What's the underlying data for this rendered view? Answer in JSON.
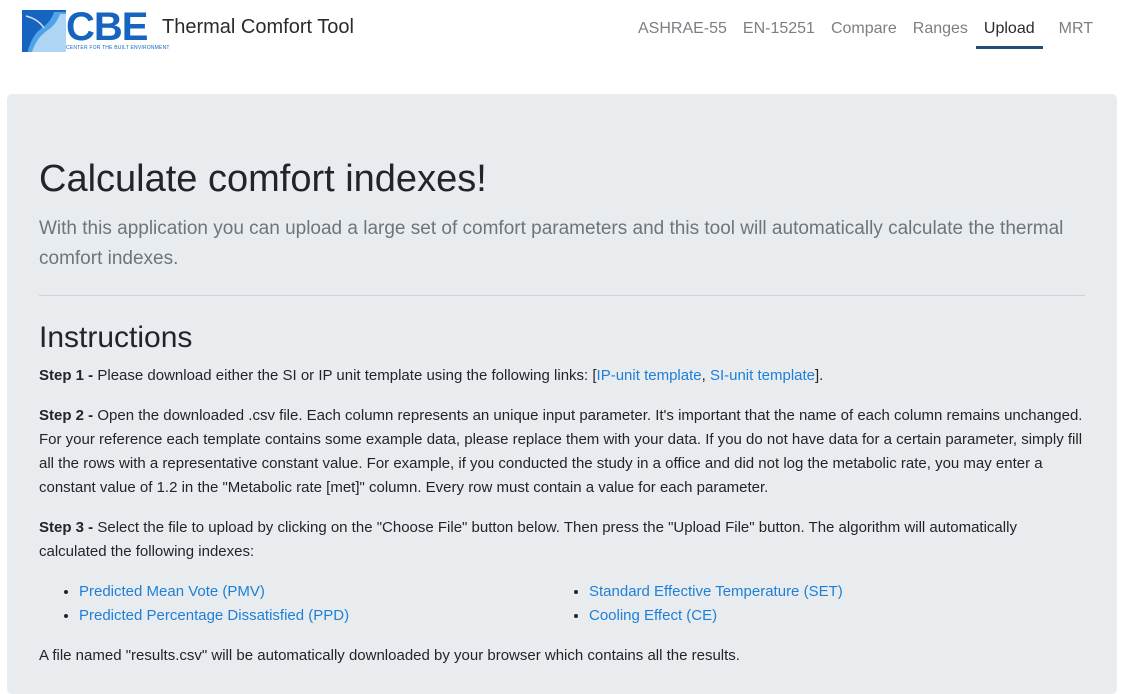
{
  "header": {
    "logo_text": "CBE",
    "logo_subtext": "CENTER FOR THE BUILT ENVIRONMENT",
    "title": "Thermal Comfort Tool",
    "nav": [
      {
        "label": "ASHRAE-55",
        "active": false
      },
      {
        "label": "EN-15251",
        "active": false
      },
      {
        "label": "Compare",
        "active": false
      },
      {
        "label": "Ranges",
        "active": false
      },
      {
        "label": "Upload",
        "active": true
      },
      {
        "label": "MRT",
        "active": false
      }
    ]
  },
  "main": {
    "heading": "Calculate comfort indexes!",
    "lead": "With this application you can upload a large set of comfort parameters and this tool will automatically calculate the thermal comfort indexes.",
    "instructions_heading": "Instructions",
    "step1": {
      "label": "Step 1 -",
      "text": "Please download either the SI or IP unit template using the following links: [",
      "link_ip": "IP-unit template",
      "sep": ", ",
      "link_si": "SI-unit template",
      "end": "]."
    },
    "step2": {
      "label": "Step 2 -",
      "text": "Open the downloaded .csv file. Each column represents an unique input parameter. It's important that the name of each column remains unchanged. For your reference each template contains some example data, please replace them with your data. If you do not have data for a certain parameter, simply fill all the rows with a representative constant value. For example, if you conducted the study in a office and did not log the metabolic rate, you may enter a constant value of 1.2 in the \"Metabolic rate [met]\" column. Every row must contain a value for each parameter."
    },
    "step3": {
      "label": "Step 3 -",
      "text": "Select the file to upload by clicking on the \"Choose File\" button below. Then press the \"Upload File\" button. The algorithm will automatically calculated the following indexes:"
    },
    "indexes_left": [
      "Predicted Mean Vote (PMV)",
      "Predicted Percentage Dissatisfied (PPD)"
    ],
    "indexes_right": [
      "Standard Effective Temperature (SET)",
      "Cooling Effect (CE)"
    ],
    "final": "A file named \"results.csv\" will be automatically downloaded by your browser which contains all the results."
  },
  "colors": {
    "brand": "#1565c0",
    "link": "#1e7fd6",
    "panel": "#e9ecef",
    "nav_active_underline": "#1f4e79"
  }
}
